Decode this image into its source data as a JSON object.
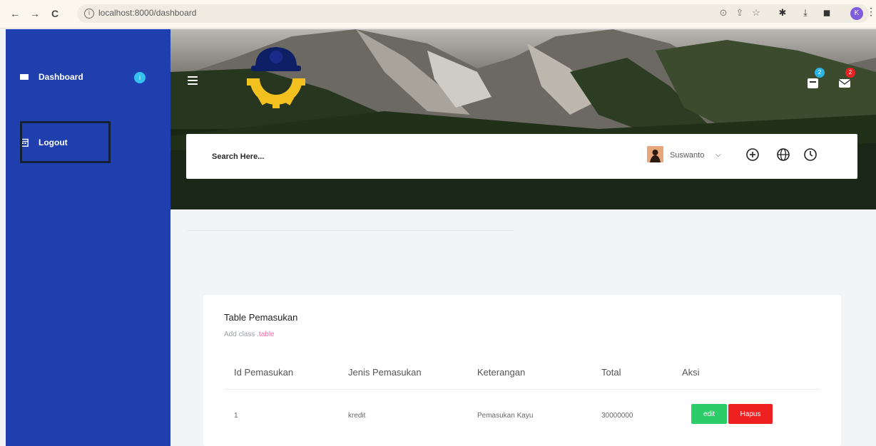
{
  "browser": {
    "back_icon": "arrow-left-icon",
    "forward_icon": "arrow-right-icon",
    "reload_icon": "reload-icon",
    "url": "localhost:8000/dashboard",
    "profile_initial": "K"
  },
  "sidebar": {
    "items": [
      {
        "label": "Dashboard",
        "icon": "dashboard-icon",
        "badge": "i"
      },
      {
        "label": "Logout",
        "icon": "calendar-icon"
      }
    ],
    "color": "#1f3fae"
  },
  "header": {
    "notifications_count": "2",
    "messages_count": "2"
  },
  "search": {
    "placeholder": "Search Here..."
  },
  "user": {
    "name": "Suswanto"
  },
  "table": {
    "title": "Table Pemasukan",
    "subtitle_text": "Add class",
    "subtitle_code": ".table",
    "columns": [
      "Id Pemasukan",
      "Jenis Pemasukan",
      "Keterangan",
      "Total",
      "Aksi"
    ],
    "rows": [
      {
        "id": "1",
        "jenis": "kredit",
        "keterangan": "Pemasukan Kayu",
        "total": "30000000",
        "edit_label": "edit",
        "delete_label": "Hapus"
      }
    ]
  }
}
